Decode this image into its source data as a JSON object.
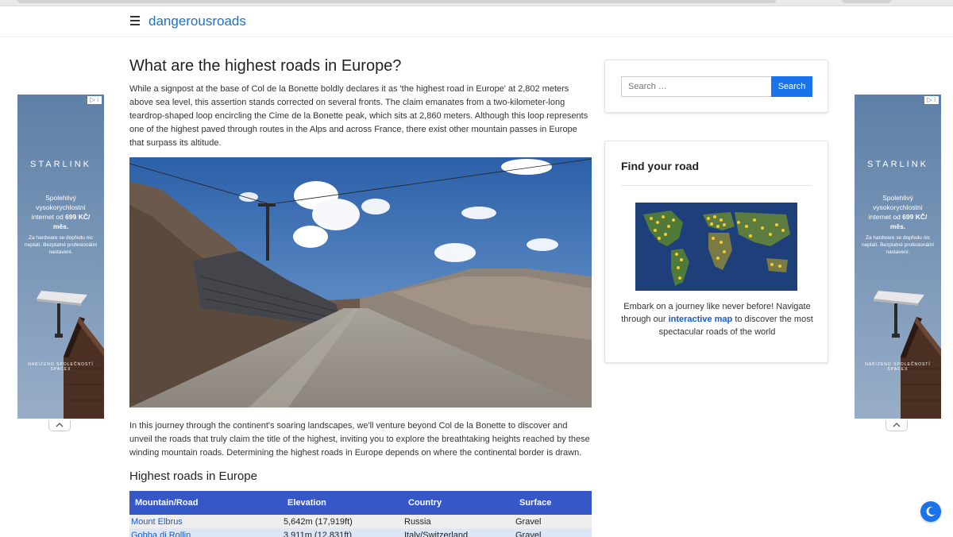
{
  "header": {
    "site_name": "dangerousroads"
  },
  "article": {
    "title": "What are the highest roads in Europe?",
    "intro": "While a signpost at the base of Col de la Bonette boldly declares it as 'the highest road in Europe' at 2,802 meters above sea level, this assertion stands corrected on several fronts. The claim emanates from a two-kilometer-long teardrop-shaped loop encircling the Cime de la Bonette peak, which sits at 2,860 meters. Although this loop represents one of the highest paved through routes in the Alps and across France, there exist other mountain passes in Europe that surpass its altitude.",
    "body": "In this journey through the continent's soaring landscapes, we'll venture beyond Col de la Bonette to discover and unveil the roads that truly claim the title of the highest, inviting you to explore the breathtaking heights reached by these winding mountain roads. Determining the highest roads in Europe depends on where the continental border is drawn.",
    "section_title": "Highest roads in Europe"
  },
  "table": {
    "headers": [
      "Mountain/Road",
      "Elevation",
      "Country",
      "Surface"
    ],
    "rows": [
      [
        "Mount Elbrus",
        "5,642m (17,919ft)",
        "Russia",
        "Gravel"
      ],
      [
        "Gobba di Rollin",
        "3.911m (12,831ft)",
        "Italy/Switzerland",
        "Gravel"
      ]
    ]
  },
  "sidebar": {
    "search_placeholder": "Search …",
    "search_button": "Search",
    "find_title": "Find your road",
    "find_text_before": "Embark on a journey like never before! Navigate through our ",
    "find_link": "interactive map",
    "find_text_after": " to discover the most spectacular roads of the world"
  },
  "ad": {
    "badge": "▷ ⁝",
    "brand": "STARLINK",
    "headline_prefix": "Spolehlivý vysokorychlostní internet od ",
    "headline_price": "699 KČ/",
    "headline_unit": "měs.",
    "sub": "Za hardware se dopředu nic neplatí. Bezplatné profesionální nastavení.",
    "footer": "NABÍZENO SPOLEČNOSTÍ SPACEX"
  },
  "colors": {
    "accent": "#1a73e8",
    "link": "#1a5bc8",
    "table_header": "#3657c8"
  },
  "icons": {
    "menu": "hamburger-menu-icon",
    "chevron": "chevron-up-icon",
    "dark_mode": "moon-icon"
  }
}
